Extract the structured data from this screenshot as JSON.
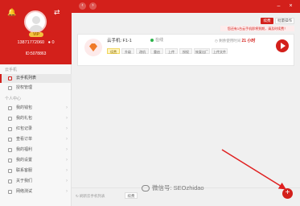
{
  "profile": {
    "vip_badge": "VIP",
    "phone": "13871772060",
    "coins": "0",
    "user_id": "ID:5078863"
  },
  "sidebar": {
    "section_cloud": "云手机",
    "cloud_items": [
      {
        "label": "云手机列表",
        "active": true
      },
      {
        "label": "授权管理",
        "active": false
      }
    ],
    "section_personal": "个人中心",
    "personal_items": [
      {
        "label": "我的钱包"
      },
      {
        "label": "我的礼包"
      },
      {
        "label": "红包记录"
      },
      {
        "label": "查看订单"
      },
      {
        "label": "我的福利"
      },
      {
        "label": "我的设置"
      },
      {
        "label": "联系客服"
      },
      {
        "label": "关于我们"
      },
      {
        "label": "网络测试"
      }
    ]
  },
  "toolbar": {
    "renew_label": "续费",
    "batch_label": "批量操作"
  },
  "notice": "您还有1台云手机即将到期，请及时续费！",
  "device": {
    "name": "云手机: F1-1",
    "status": "在线",
    "expire_label": "剩余使用时间",
    "expire_days": "21 小时",
    "actions": [
      "续费",
      "升级",
      "改机",
      "重启",
      "上传",
      "授权",
      "恢复出厂",
      "上传文件"
    ]
  },
  "footer": {
    "refresh_label": "刷新云手机列表",
    "renew_label": "续费"
  },
  "watermark": "微信号: SEOzhidao",
  "colors": {
    "brand": "#d3201b",
    "online": "#2cb34a"
  }
}
